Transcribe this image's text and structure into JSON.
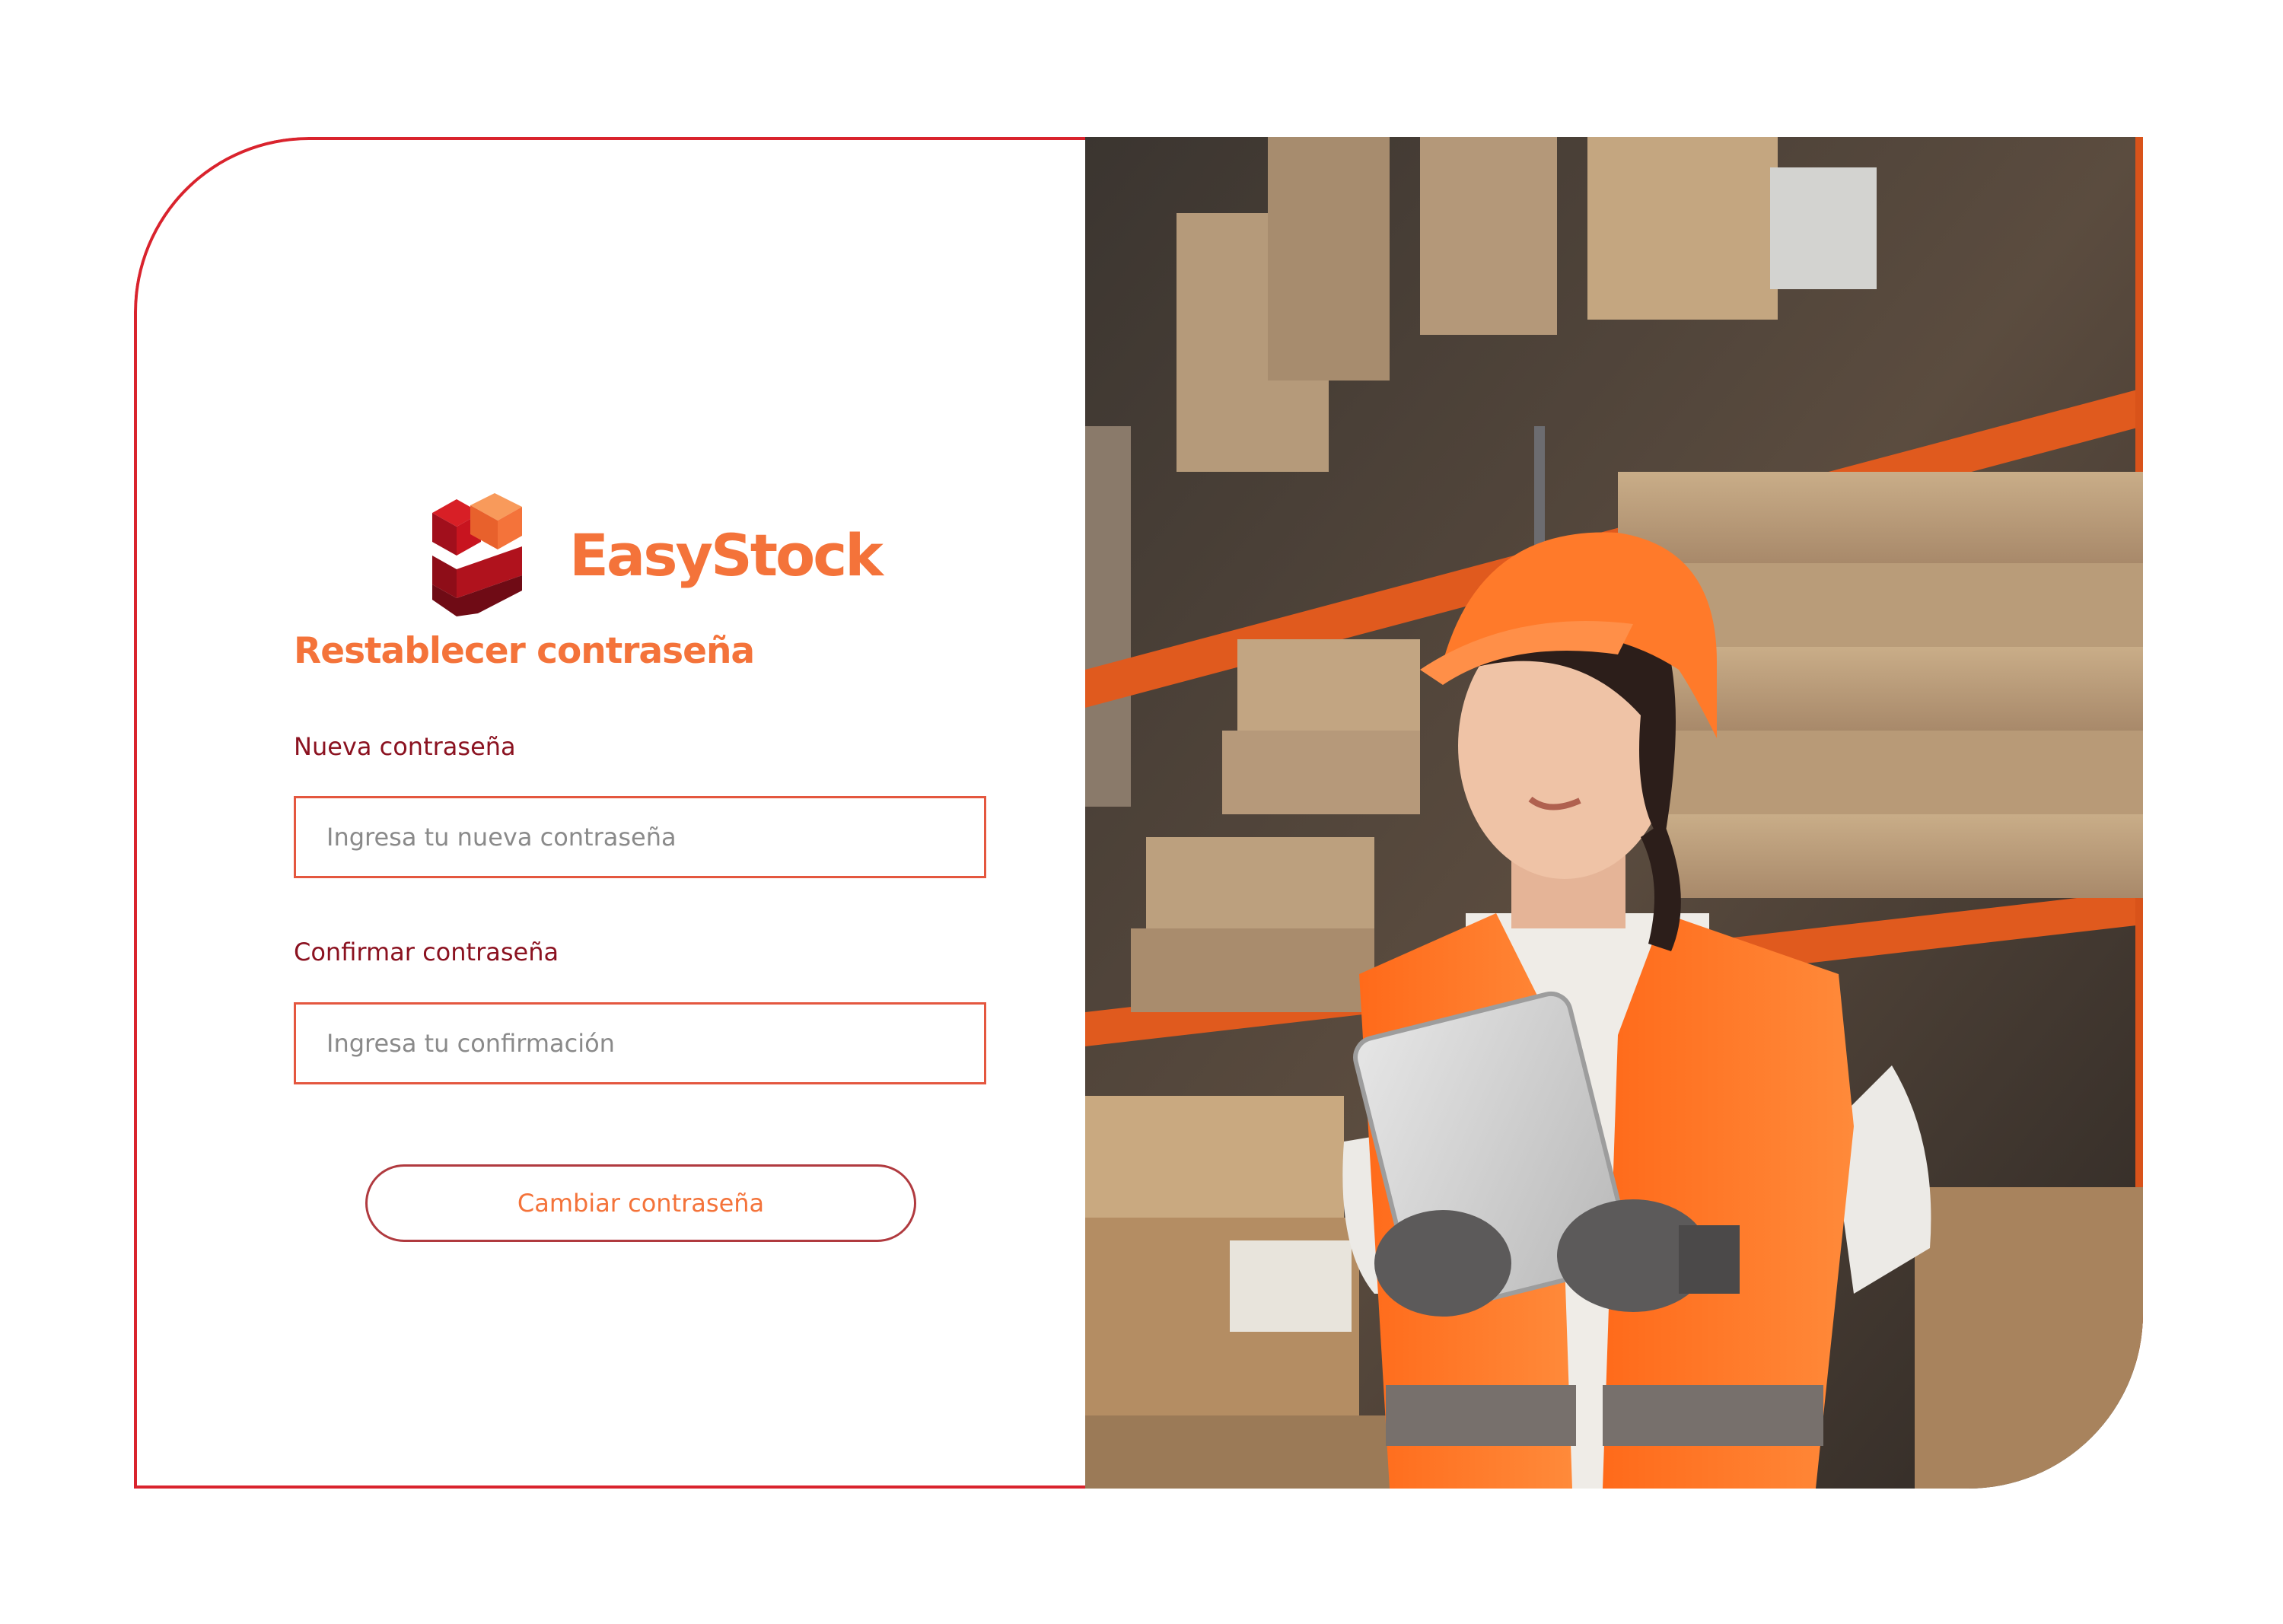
{
  "brand": {
    "name": "EasyStock",
    "logo_icon": "cube-logo-icon"
  },
  "page": {
    "title": "Restablecer contraseña"
  },
  "form": {
    "new_password": {
      "label": "Nueva contraseña",
      "placeholder": "Ingresa tu nueva contraseña",
      "value": ""
    },
    "confirm_password": {
      "label": "Confirmar contraseña",
      "placeholder": "Ingresa tu confirmación",
      "value": ""
    },
    "submit_label": "Cambiar contraseña"
  },
  "colors": {
    "accent_orange": "#f4733a",
    "border_red": "#d9232d",
    "label_maroon": "#8b1220"
  },
  "illustration": {
    "subject": "warehouse-worker-photo"
  }
}
